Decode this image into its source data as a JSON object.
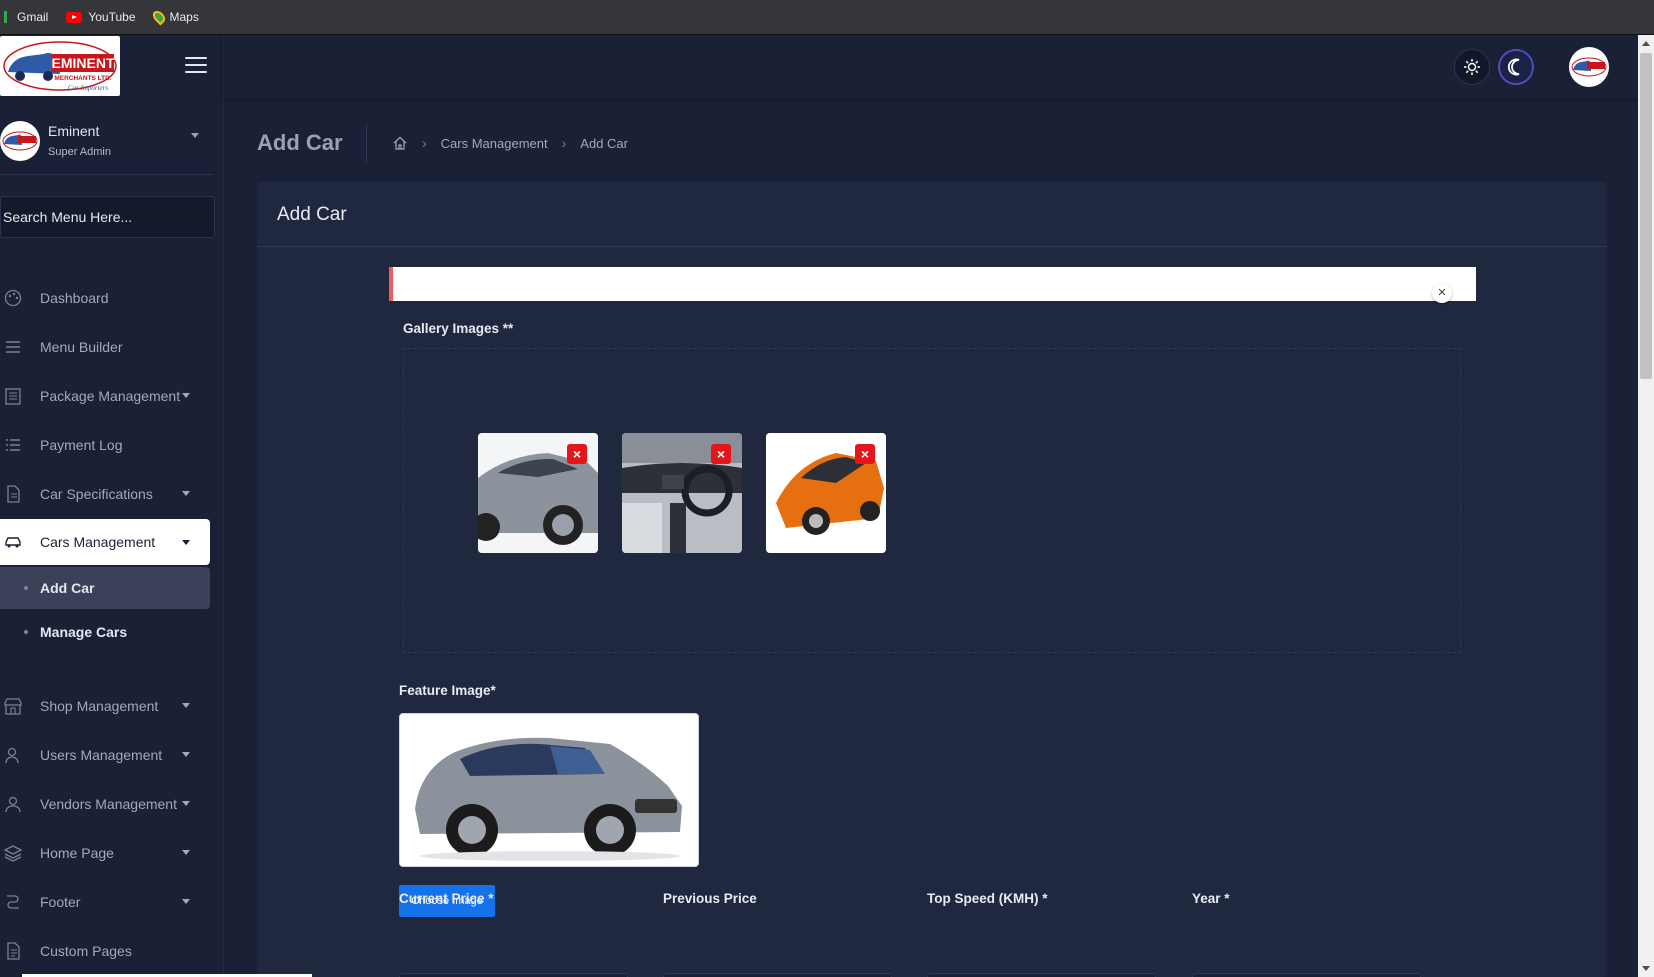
{
  "bookmarks": [
    {
      "label": "Gmail",
      "icon": "gmail-icon"
    },
    {
      "label": "YouTube",
      "icon": "youtube-icon"
    },
    {
      "label": "Maps",
      "icon": "maps-icon"
    }
  ],
  "brand": {
    "logo_text": "EMINENT",
    "logo_sub": "MERCHANTS LTD.",
    "logo_tag": "Car Importers"
  },
  "user": {
    "name": "Eminent",
    "role": "Super Admin"
  },
  "search": {
    "placeholder": "Search Menu Here..."
  },
  "menu": {
    "dashboard": "Dashboard",
    "menu_builder": "Menu Builder",
    "package_management": "Package Management",
    "payment_log": "Payment Log",
    "car_specifications": "Car Specifications",
    "cars_management": "Cars Management",
    "add_car": "Add Car",
    "manage_cars": "Manage Cars",
    "shop_management": "Shop Management",
    "users_management": "Users Management",
    "vendors_management": "Vendors Management",
    "home_page": "Home Page",
    "footer": "Footer",
    "custom_pages": "Custom Pages"
  },
  "page": {
    "title": "Add Car",
    "breadcrumb": [
      "Cars Management",
      "Add Car"
    ]
  },
  "card": {
    "title": "Add Car",
    "gallery_label": "Gallery Images **",
    "feature_label": "Feature Image*",
    "choose_button": "Choose Image",
    "fields": [
      "Current Price *",
      "Previous Price",
      "Top Speed (KMH) *",
      "Year *"
    ]
  },
  "colors": {
    "background": "#1a2035",
    "card": "#1f283e",
    "accent": "#1572e8",
    "danger": "#e4161c"
  }
}
